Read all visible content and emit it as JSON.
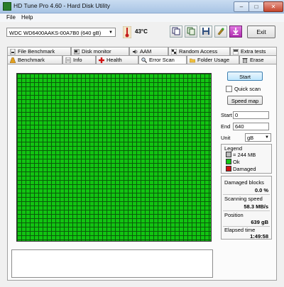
{
  "window": {
    "title": "HD Tune Pro 4.60 - Hard Disk Utility",
    "min_glyph": "–",
    "max_glyph": "□",
    "close_glyph": "✕"
  },
  "menu": {
    "file": "File",
    "help": "Help"
  },
  "toolbar": {
    "drive": "WDC WD6400AAKS-00A7B0 (640 gB)",
    "temperature": "43°C",
    "exit_label": "Exit"
  },
  "tabs_row1": [
    {
      "label": "File Benchmark"
    },
    {
      "label": "Disk monitor"
    },
    {
      "label": "AAM"
    },
    {
      "label": "Random Access"
    },
    {
      "label": "Extra tests"
    }
  ],
  "tabs_row2": [
    {
      "label": "Benchmark"
    },
    {
      "label": "Info"
    },
    {
      "label": "Health"
    },
    {
      "label": "Error Scan"
    },
    {
      "label": "Folder Usage"
    },
    {
      "label": "Erase"
    }
  ],
  "controls": {
    "start_label": "Start",
    "quick_scan_label": "Quick scan",
    "quick_scan_checked": false,
    "speed_map_label": "Speed map",
    "start_field_label": "Start",
    "start_value": "0",
    "end_field_label": "End",
    "end_value": "640",
    "unit_label": "Unit",
    "unit_value": "gB"
  },
  "legend": {
    "title": "Legend",
    "block_size": "= 244 MB",
    "ok": "Ok",
    "damaged": "Damaged",
    "ok_color": "#12c412",
    "damaged_color": "#d01010"
  },
  "stats": {
    "damaged_blocks_label": "Damaged blocks",
    "damaged_blocks_value": "0.0 %",
    "scanning_speed_label": "Scanning speed",
    "scanning_speed_value": "58.3 MB/s",
    "position_label": "Position",
    "position_value": "639 gB",
    "elapsed_label": "Elapsed time",
    "elapsed_value": "1:49:58"
  }
}
